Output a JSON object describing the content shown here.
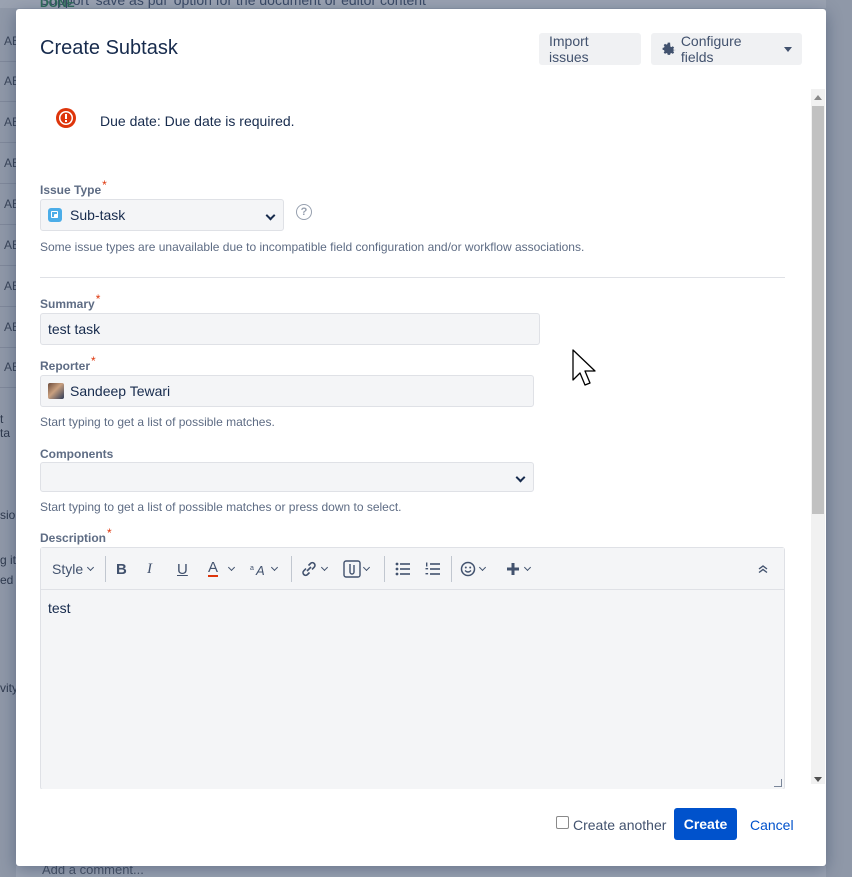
{
  "background": {
    "top_text": "Support 'save as pdf' option for the document or editor content",
    "top_right_text": "DONE",
    "left_rows": [
      "AB",
      "AB",
      "AB",
      "AB",
      "AB",
      "AB",
      "AB",
      "AB",
      "AB"
    ],
    "left_fragment_1": "t ta",
    "left_fragment_2": "sio",
    "left_fragment_3": "g it",
    "left_fragment_4": "ed",
    "left_fragment_5": "vity",
    "comment_placeholder": "Add a comment..."
  },
  "dialog": {
    "title": "Create Subtask",
    "import_button": "Import issues",
    "configure_button": "Configure fields",
    "error_message": "Due date: Due date is required.",
    "issue_type": {
      "label": "Issue Type",
      "required": "*",
      "value": "Sub-task",
      "help_glyph": "?",
      "help_text": "Some issue types are unavailable due to incompatible field configuration and/or workflow associations."
    },
    "summary": {
      "label": "Summary",
      "required": "*",
      "value": "test task"
    },
    "reporter": {
      "label": "Reporter",
      "required": "*",
      "value": "Sandeep Tewari",
      "help_text": "Start typing to get a list of possible matches."
    },
    "components": {
      "label": "Components",
      "value": "",
      "help_text": "Start typing to get a list of possible matches or press down to select."
    },
    "description": {
      "label": "Description",
      "required": "*",
      "toolbar_style": "Style",
      "toolbar_bold": "B",
      "toolbar_italic": "I",
      "toolbar_underline": "U",
      "toolbar_color": "A",
      "value": "test"
    },
    "footer": {
      "create_another_label": "Create another",
      "create_another_checked": false,
      "create_button": "Create",
      "cancel_link": "Cancel"
    }
  },
  "colors": {
    "primary": "#0052cc",
    "error": "#de350b",
    "required": "#de350b",
    "field_bg": "#f4f5f7",
    "overlay": "#8f98a8"
  }
}
